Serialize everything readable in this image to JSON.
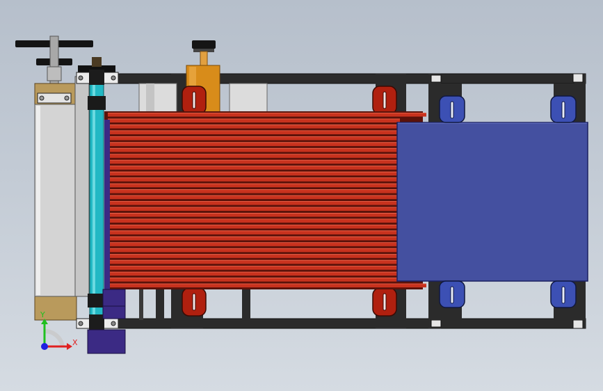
{
  "view": {
    "background_top": "#b6bfcb",
    "background_bottom": "#d5dbe2"
  },
  "colors": {
    "frame": "#2b2b2b",
    "red_blade": "#c8321e",
    "red_blade_dark": "#5a120a",
    "red_bracket": "#b0200f",
    "blue_plate": "#4450a0",
    "blue_clip": "#3c50b4",
    "cyan_roller": "#22b8c4",
    "grey_housing": "#d4d4d4",
    "tan_block": "#b99a5c",
    "orange_motor": "#d88c1a",
    "purple_block": "#3b2a84"
  },
  "triad": {
    "x_label": "X",
    "y_label": "Y",
    "x_color": "#e02020",
    "y_color": "#20c020",
    "z_color": "#2020e0"
  },
  "parts": {
    "blade_count": 30,
    "bracket_count": 4,
    "clip_count": 4
  }
}
